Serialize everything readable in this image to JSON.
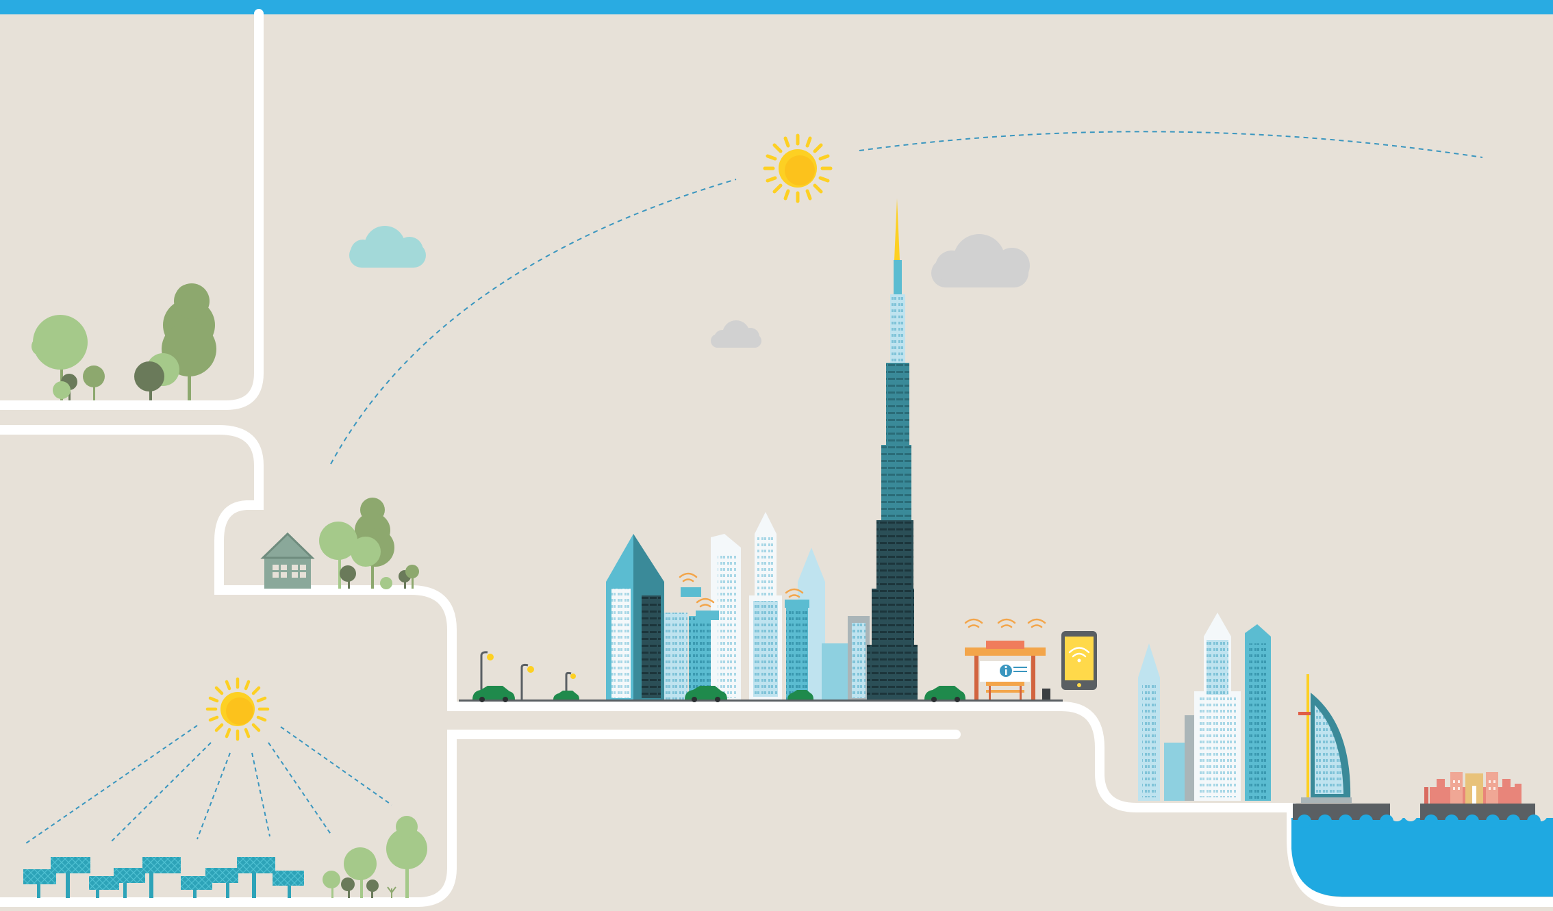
{
  "colors": {
    "background": "#e7e1d8",
    "top_bar": "#29abe2",
    "path": "#ffffff",
    "sun": "#fdd023",
    "sun_core": "#fcc21c",
    "sky_dashes": "#3a96bf",
    "cloud_blue": "#a3d9d9",
    "cloud_grey": "#d1d1d1",
    "tree_light": "#a5c98a",
    "tree_mid": "#8da86e",
    "tree_dark": "#6a7a5a",
    "tower_dark": "#2b4f57",
    "tower_teal": "#3a8a99",
    "building_light": "#bfe3ef",
    "building_teal": "#5bbcd1",
    "building_white": "#f4f8fa",
    "car": "#1f8a4c",
    "wifi": "#f3a54a",
    "bus_stop_roof": "#f3a54a",
    "phone": "#ffd94a",
    "water": "#1fa9e1",
    "pier": "#5a5f63",
    "resort": "#e8857a",
    "solar_panel": "#2da3b8"
  },
  "icons": {
    "sun": "sun-icon",
    "wifi": "wifi-icon",
    "info": "info-icon",
    "phone": "smartphone-icon"
  }
}
